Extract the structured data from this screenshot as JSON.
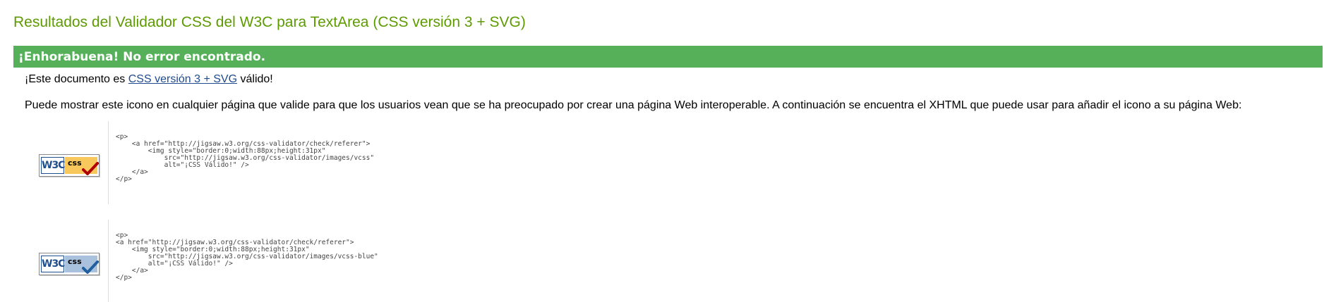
{
  "page_title": "Resultados del Validador CSS del W3C para TextArea (CSS versión 3 + SVG)",
  "banner": "¡Enhorabuena! No error encontrado.",
  "valid_message": {
    "prefix": "¡Este documento es ",
    "link": "CSS versión 3 + SVG",
    "suffix": " válido!"
  },
  "icon_info": "Puede mostrar este icono en cualquier página que valide para que los usuarios vean que se ha preocupado por crear una página Web interoperable. A continuación se encuentra el XHTML que puede usar para añadir el icono a su página Web:",
  "badges": [
    {
      "w3c": "W3C",
      "css": "css",
      "color": "#f8c85c",
      "check_color": "#b00000"
    },
    {
      "w3c": "W3C",
      "css": "css",
      "color": "#a9c1dc",
      "check_color": "#1f5fa0"
    }
  ],
  "snippets": [
    "<p>\n    <a href=\"http://jigsaw.w3.org/css-validator/check/referer\">\n        <img style=\"border:0;width:88px;height:31px\"\n            src=\"http://jigsaw.w3.org/css-validator/images/vcss\"\n            alt=\"¡CSS Válido!\" />\n    </a>\n</p>",
    "<p>\n<a href=\"http://jigsaw.w3.org/css-validator/check/referer\">\n    <img style=\"border:0;width:88px;height:31px\"\n        src=\"http://jigsaw.w3.org/css-validator/images/vcss-blue\"\n        alt=\"¡CSS Válido!\" />\n    </a>\n</p>"
  ]
}
